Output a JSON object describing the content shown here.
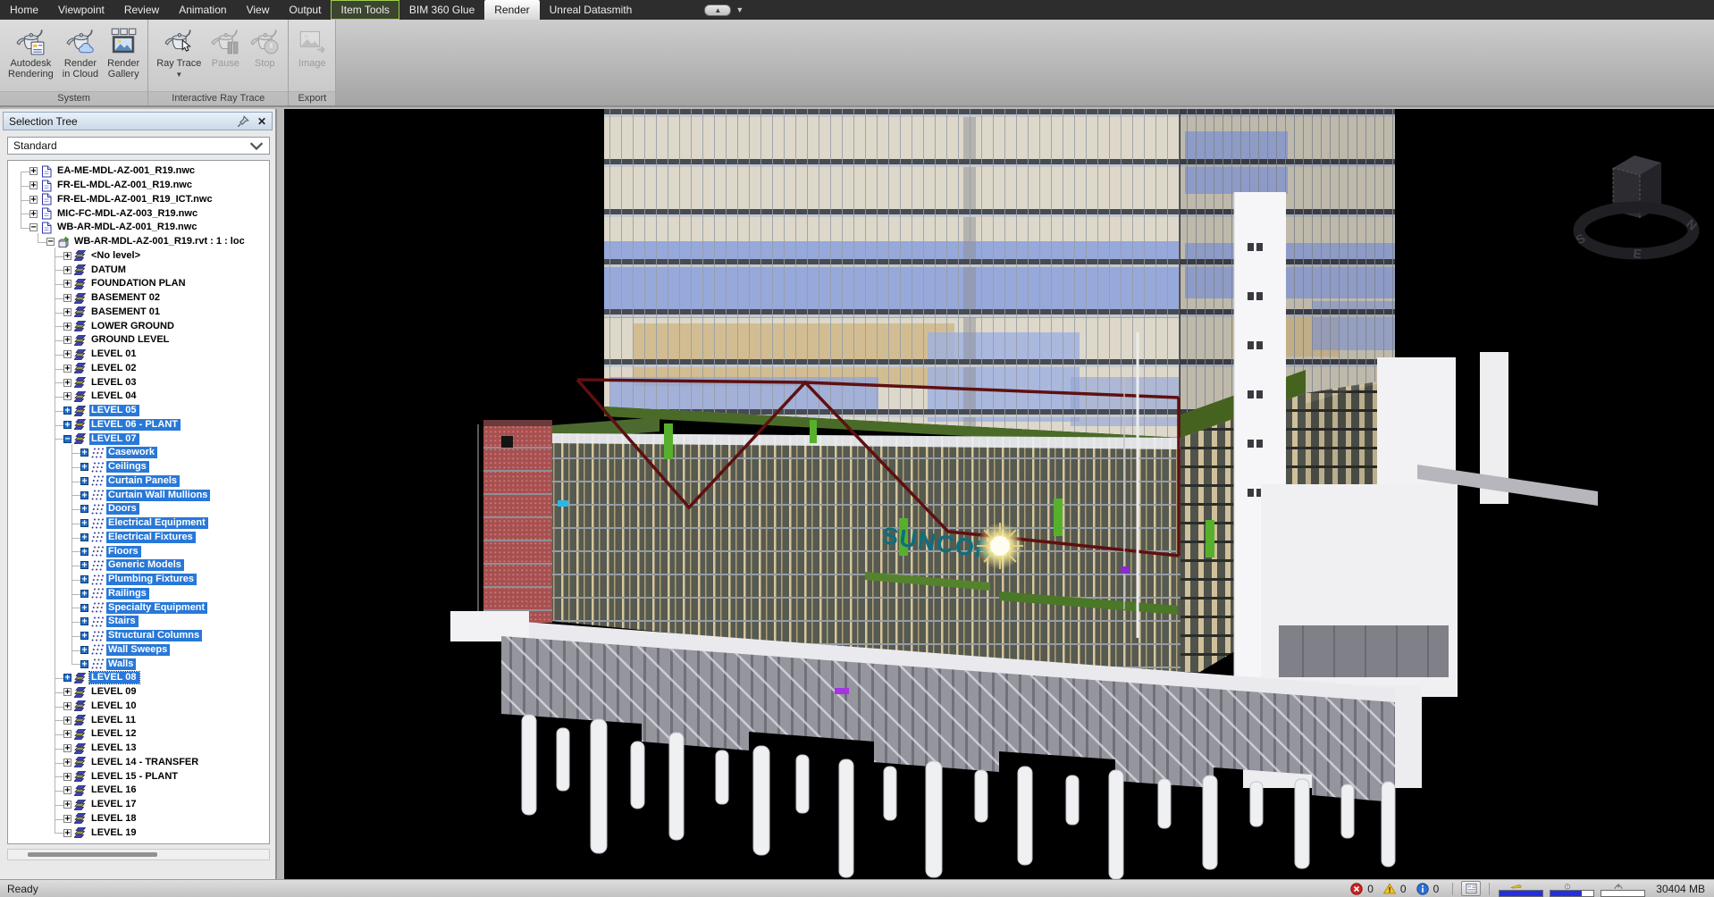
{
  "menu": {
    "tabs": [
      {
        "label": "Home"
      },
      {
        "label": "Viewpoint"
      },
      {
        "label": "Review"
      },
      {
        "label": "Animation"
      },
      {
        "label": "View"
      },
      {
        "label": "Output"
      },
      {
        "label": "Item Tools",
        "highlight": true
      },
      {
        "label": "BIM 360 Glue"
      },
      {
        "label": "Render",
        "active": true
      },
      {
        "label": "Unreal Datasmith"
      }
    ]
  },
  "ribbon": {
    "groups": [
      {
        "label": "System",
        "buttons": [
          {
            "lines": [
              "Autodesk",
              "Rendering"
            ],
            "icon": "teapot-render-icon",
            "enabled": true
          },
          {
            "lines": [
              "Render",
              "in Cloud"
            ],
            "icon": "teapot-cloud-icon",
            "enabled": true
          },
          {
            "lines": [
              "Render",
              "Gallery"
            ],
            "icon": "render-gallery-icon",
            "enabled": true
          }
        ]
      },
      {
        "label": "Interactive Ray Trace",
        "buttons": [
          {
            "lines": [
              "Ray Trace"
            ],
            "icon": "teapot-raytrace-icon",
            "enabled": true,
            "dropdown": true
          },
          {
            "lines": [
              "Pause"
            ],
            "icon": "teapot-pause-icon",
            "enabled": false
          },
          {
            "lines": [
              "Stop"
            ],
            "icon": "teapot-stop-icon",
            "enabled": false
          }
        ]
      },
      {
        "label": "Export",
        "buttons": [
          {
            "lines": [
              "Image"
            ],
            "icon": "image-export-icon",
            "enabled": false
          }
        ]
      }
    ]
  },
  "panel": {
    "title": "Selection Tree",
    "combo_value": "Standard",
    "tree": [
      {
        "label": "EA-ME-MDL-AZ-001_R19.nwc",
        "depth": 1,
        "icon": "nwc-file-icon",
        "expand": "plus"
      },
      {
        "label": "FR-EL-MDL-AZ-001_R19.nwc",
        "depth": 1,
        "icon": "nwc-file-icon",
        "expand": "plus"
      },
      {
        "label": "FR-EL-MDL-AZ-001_R19_ICT.nwc",
        "depth": 1,
        "icon": "nwc-file-icon",
        "expand": "plus"
      },
      {
        "label": "MIC-FC-MDL-AZ-003_R19.nwc",
        "depth": 1,
        "icon": "nwc-file-icon",
        "expand": "plus"
      },
      {
        "label": "WB-AR-MDL-AZ-001_R19.nwc",
        "depth": 1,
        "icon": "nwc-file-icon",
        "expand": "minus"
      },
      {
        "label": "WB-AR-MDL-AZ-001_R19.rvt : 1 : loc",
        "depth": 2,
        "icon": "rvt-file-icon",
        "expand": "minus"
      },
      {
        "label": "<No level>",
        "depth": 3,
        "icon": "level-icon",
        "expand": "plus"
      },
      {
        "label": "DATUM",
        "depth": 3,
        "icon": "level-icon",
        "expand": "plus"
      },
      {
        "label": "FOUNDATION PLAN",
        "depth": 3,
        "icon": "level-icon",
        "expand": "plus"
      },
      {
        "label": "BASEMENT 02",
        "depth": 3,
        "icon": "level-icon",
        "expand": "plus"
      },
      {
        "label": "BASEMENT 01",
        "depth": 3,
        "icon": "level-icon",
        "expand": "plus"
      },
      {
        "label": "LOWER GROUND",
        "depth": 3,
        "icon": "level-icon",
        "expand": "plus"
      },
      {
        "label": "GROUND LEVEL",
        "depth": 3,
        "icon": "level-icon",
        "expand": "plus"
      },
      {
        "label": "LEVEL 01",
        "depth": 3,
        "icon": "level-icon",
        "expand": "plus"
      },
      {
        "label": "LEVEL 02",
        "depth": 3,
        "icon": "level-icon",
        "expand": "plus"
      },
      {
        "label": "LEVEL 03",
        "depth": 3,
        "icon": "level-icon",
        "expand": "plus"
      },
      {
        "label": "LEVEL 04",
        "depth": 3,
        "icon": "level-icon",
        "expand": "plus"
      },
      {
        "label": "LEVEL 05",
        "depth": 3,
        "icon": "level-icon",
        "expand": "plus",
        "selected": true
      },
      {
        "label": "LEVEL 06 - PLANT",
        "depth": 3,
        "icon": "level-icon",
        "expand": "plus",
        "selected": true
      },
      {
        "label": "LEVEL 07",
        "depth": 3,
        "icon": "level-icon",
        "expand": "minus",
        "selected": true
      },
      {
        "label": "Casework",
        "depth": 4,
        "icon": "category-icon",
        "expand": "plus",
        "selected": true
      },
      {
        "label": "Ceilings",
        "depth": 4,
        "icon": "category-icon",
        "expand": "plus",
        "selected": true
      },
      {
        "label": "Curtain Panels",
        "depth": 4,
        "icon": "category-icon",
        "expand": "plus",
        "selected": true
      },
      {
        "label": "Curtain Wall Mullions",
        "depth": 4,
        "icon": "category-icon",
        "expand": "plus",
        "selected": true
      },
      {
        "label": "Doors",
        "depth": 4,
        "icon": "category-icon",
        "expand": "plus",
        "selected": true
      },
      {
        "label": "Electrical Equipment",
        "depth": 4,
        "icon": "category-icon",
        "expand": "plus",
        "selected": true
      },
      {
        "label": "Electrical Fixtures",
        "depth": 4,
        "icon": "category-icon",
        "expand": "plus",
        "selected": true
      },
      {
        "label": "Floors",
        "depth": 4,
        "icon": "category-icon",
        "expand": "plus",
        "selected": true
      },
      {
        "label": "Generic Models",
        "depth": 4,
        "icon": "category-icon",
        "expand": "plus",
        "selected": true
      },
      {
        "label": "Plumbing Fixtures",
        "depth": 4,
        "icon": "category-icon",
        "expand": "plus",
        "selected": true
      },
      {
        "label": "Railings",
        "depth": 4,
        "icon": "category-icon",
        "expand": "plus",
        "selected": true
      },
      {
        "label": "Specialty Equipment",
        "depth": 4,
        "icon": "category-icon",
        "expand": "plus",
        "selected": true
      },
      {
        "label": "Stairs",
        "depth": 4,
        "icon": "category-icon",
        "expand": "plus",
        "selected": true
      },
      {
        "label": "Structural Columns",
        "depth": 4,
        "icon": "category-icon",
        "expand": "plus",
        "selected": true
      },
      {
        "label": "Wall Sweeps",
        "depth": 4,
        "icon": "category-icon",
        "expand": "plus",
        "selected": true
      },
      {
        "label": "Walls",
        "depth": 4,
        "icon": "category-icon",
        "expand": "plus",
        "selected": true
      },
      {
        "label": "LEVEL 08",
        "depth": 3,
        "icon": "level-icon",
        "expand": "plus",
        "selected": true,
        "focus": true
      },
      {
        "label": "LEVEL 09",
        "depth": 3,
        "icon": "level-icon",
        "expand": "plus"
      },
      {
        "label": "LEVEL 10",
        "depth": 3,
        "icon": "level-icon",
        "expand": "plus"
      },
      {
        "label": "LEVEL 11",
        "depth": 3,
        "icon": "level-icon",
        "expand": "plus"
      },
      {
        "label": "LEVEL 12",
        "depth": 3,
        "icon": "level-icon",
        "expand": "plus"
      },
      {
        "label": "LEVEL 13",
        "depth": 3,
        "icon": "level-icon",
        "expand": "plus"
      },
      {
        "label": "LEVEL 14 - TRANSFER",
        "depth": 3,
        "icon": "level-icon",
        "expand": "plus"
      },
      {
        "label": "LEVEL 15 - PLANT",
        "depth": 3,
        "icon": "level-icon",
        "expand": "plus"
      },
      {
        "label": "LEVEL 16",
        "depth": 3,
        "icon": "level-icon",
        "expand": "plus"
      },
      {
        "label": "LEVEL 17",
        "depth": 3,
        "icon": "level-icon",
        "expand": "plus"
      },
      {
        "label": "LEVEL 18",
        "depth": 3,
        "icon": "level-icon",
        "expand": "plus"
      },
      {
        "label": "LEVEL 19",
        "depth": 3,
        "icon": "level-icon",
        "expand": "plus"
      }
    ]
  },
  "viewport": {
    "sign": "SUNCORP",
    "viewcube": [
      "S",
      "E",
      "N"
    ]
  },
  "status": {
    "ready": "Ready",
    "errors": "0",
    "warnings": "0",
    "infos": "0",
    "memory": "30404 MB"
  }
}
